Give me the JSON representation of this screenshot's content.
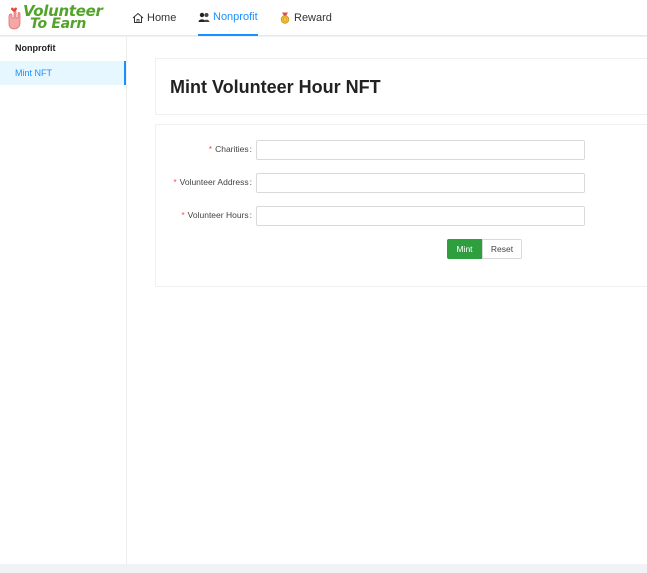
{
  "header": {
    "logo": {
      "line1": "Volunteer",
      "line2": "To Earn",
      "icon": "hand-heart-icon",
      "color": "#52a32a"
    },
    "nav": [
      {
        "label": "Home",
        "icon": "home-icon",
        "active": false
      },
      {
        "label": "Nonprofit",
        "icon": "people-icon",
        "active": true
      },
      {
        "label": "Reward",
        "icon": "medal-icon",
        "active": false
      }
    ]
  },
  "sidebar": {
    "title": "Nonprofit",
    "items": [
      {
        "label": "Mint NFT",
        "selected": true
      }
    ]
  },
  "main": {
    "title": "Mint Volunteer Hour NFT",
    "form": {
      "fields": [
        {
          "label": "Charities",
          "required": true,
          "value": "",
          "placeholder": ""
        },
        {
          "label": "Volunteer Address",
          "required": true,
          "value": "",
          "placeholder": ""
        },
        {
          "label": "Volunteer Hours",
          "required": true,
          "value": "",
          "placeholder": ""
        }
      ],
      "mint_label": "Mint",
      "reset_label": "Reset"
    }
  },
  "colors": {
    "accent": "#1890ff",
    "primary_button": "#2e9e3e",
    "required": "#ff4d4f"
  }
}
